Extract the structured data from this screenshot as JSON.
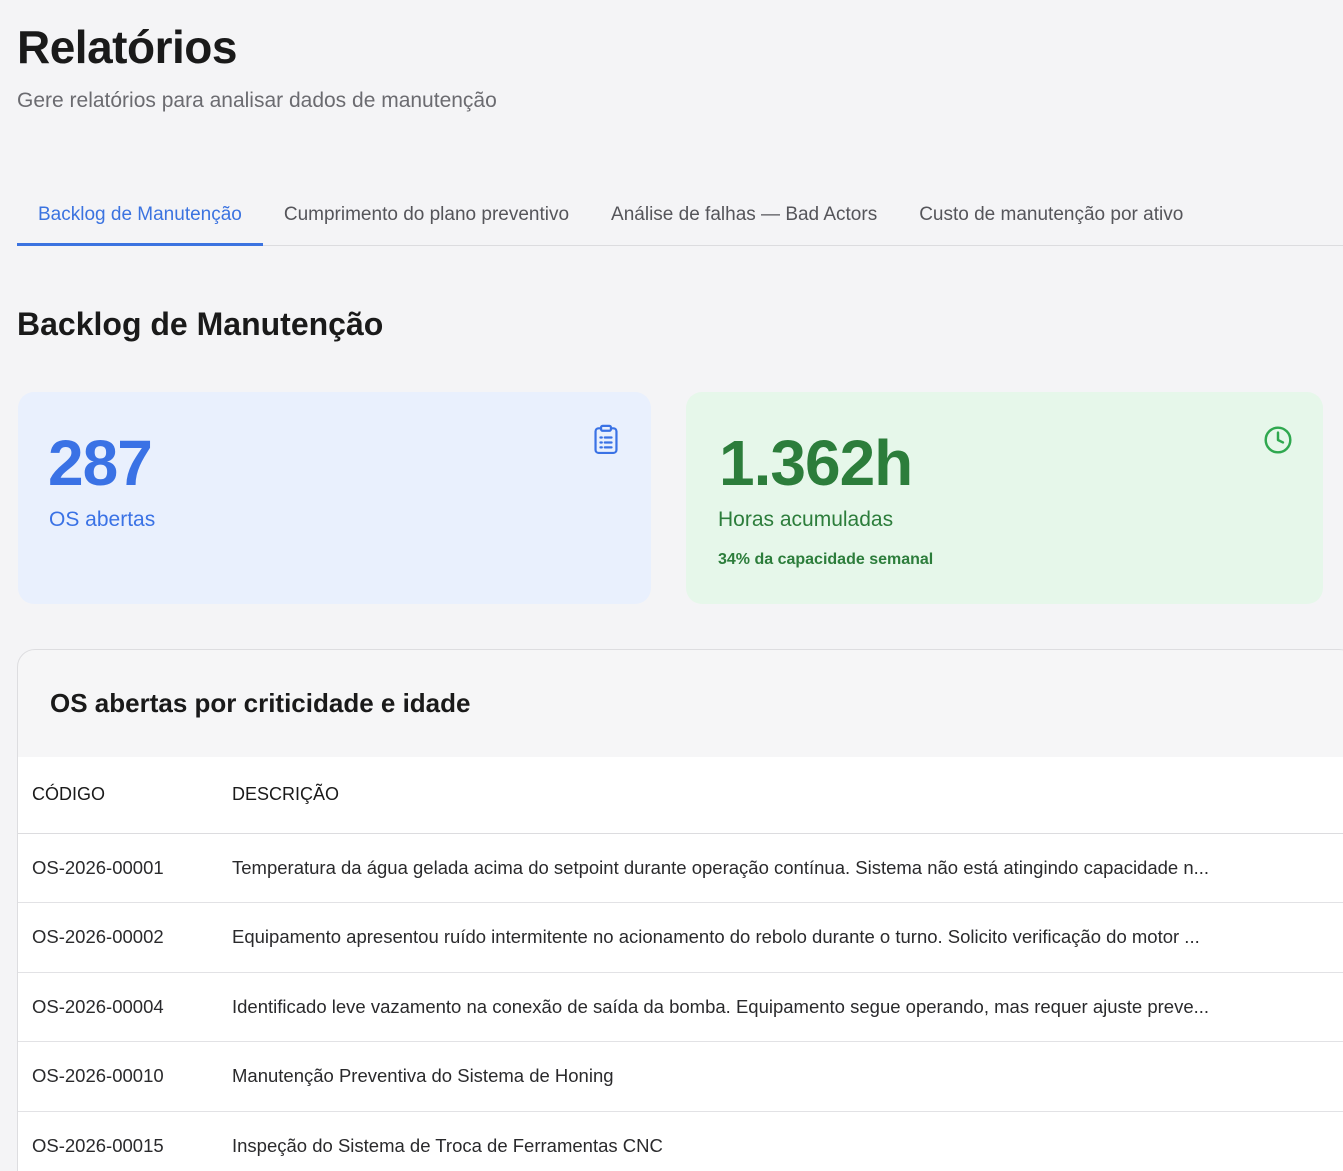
{
  "header": {
    "title": "Relatórios",
    "subtitle": "Gere relatórios para analisar dados de manutenção"
  },
  "tabs": [
    {
      "label": "Backlog de Manutenção",
      "active": true
    },
    {
      "label": "Cumprimento do plano preventivo",
      "active": false
    },
    {
      "label": "Análise de falhas — Bad Actors",
      "active": false
    },
    {
      "label": "Custo de manutenção por ativo",
      "active": false
    }
  ],
  "section": {
    "title": "Backlog de Manutenção"
  },
  "kpis": {
    "open_orders": {
      "value": "287",
      "label": "OS abertas",
      "icon": "clipboard-list-icon",
      "color": "#3a72e5"
    },
    "hours": {
      "value": "1.362h",
      "label": "Horas acumuladas",
      "note": "34% da capacidade semanal",
      "icon": "clock-icon",
      "color": "#2c7d3b"
    }
  },
  "table_card": {
    "title": "OS abertas por criticidade e idade",
    "columns": [
      "CÓDIGO",
      "DESCRIÇÃO"
    ],
    "rows": [
      {
        "code": "OS-2026-00001",
        "description": "Temperatura da água gelada acima do setpoint durante operação contínua. Sistema não está atingindo capacidade n..."
      },
      {
        "code": "OS-2026-00002",
        "description": "Equipamento apresentou ruído intermitente no acionamento do rebolo durante o turno. Solicito verificação do motor ..."
      },
      {
        "code": "OS-2026-00004",
        "description": "Identificado leve vazamento na conexão de saída da bomba. Equipamento segue operando, mas requer ajuste preve..."
      },
      {
        "code": "OS-2026-00010",
        "description": "Manutenção Preventiva do Sistema de Honing"
      },
      {
        "code": "OS-2026-00015",
        "description": "Inspeção do Sistema de Troca de Ferramentas CNC"
      }
    ]
  }
}
